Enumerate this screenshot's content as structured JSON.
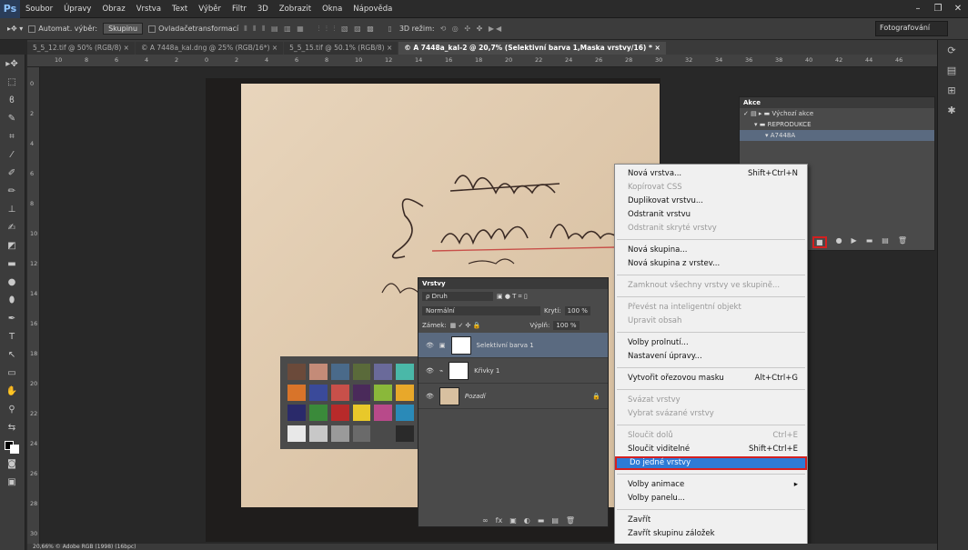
{
  "menubar": {
    "logo": "Ps",
    "items": [
      "Soubor",
      "Úpravy",
      "Obraz",
      "Vrstva",
      "Text",
      "Výběr",
      "Filtr",
      "3D",
      "Zobrazit",
      "Okna",
      "Nápověda"
    ]
  },
  "options": {
    "auto_select": "Automat. výběr:",
    "group": "Skupinu",
    "transform": "Ovladačetransformací",
    "mode3d": "3D režim:",
    "workspace": "Fotografování"
  },
  "tabs": [
    "5_5_12.tif @ 50% (RGB/8) ×",
    "© A 7448a_kal.dng @ 25% (RGB/16*) ×",
    "5_5_15.tif @ 50.1% (RGB/8) ×",
    "© A 7448a_kal-2 @ 20,7% (Selektivní barva 1,Maska vrstvy/16) * ×"
  ],
  "ruler_top": [
    "10",
    "8",
    "6",
    "4",
    "2",
    "0",
    "2",
    "4",
    "6",
    "8",
    "10",
    "12",
    "14",
    "16",
    "18",
    "20",
    "22",
    "24",
    "26",
    "28",
    "30",
    "32",
    "34",
    "36",
    "38",
    "40",
    "42",
    "44",
    "46"
  ],
  "ruler_left": [
    "0",
    "2",
    "4",
    "6",
    "8",
    "10",
    "12",
    "14",
    "16",
    "18",
    "20",
    "22",
    "24",
    "26",
    "28",
    "30"
  ],
  "status": "20,66%   © Adobe RGB (1998) (16bpc)",
  "actions": {
    "title": "Akce",
    "rows": [
      "Výchozí akce",
      "REPRODUKCE",
      "A7448A"
    ]
  },
  "layers": {
    "title": "Vrstvy",
    "filter": "ρ Druh",
    "blend": "Normální",
    "opacity_label": "Krytí:",
    "opacity": "100 %",
    "lock_label": "Zámek:",
    "fill_label": "Výplň:",
    "fill": "100 %",
    "items": [
      {
        "name": "Selektivní barva 1"
      },
      {
        "name": "Křivky 1"
      },
      {
        "name": "Pozadí"
      }
    ]
  },
  "context_menu": [
    {
      "label": "Nová vrstva...",
      "shortcut": "Shift+Ctrl+N"
    },
    {
      "label": "Kopírovat CSS",
      "disabled": true
    },
    {
      "label": "Duplikovat vrstvu..."
    },
    {
      "label": "Odstranit vrstvu"
    },
    {
      "label": "Odstranit skryté vrstvy",
      "disabled": true
    },
    {
      "sep": true
    },
    {
      "label": "Nová skupina..."
    },
    {
      "label": "Nová skupina z vrstev..."
    },
    {
      "sep": true
    },
    {
      "label": "Zamknout všechny vrstvy ve skupině...",
      "disabled": true
    },
    {
      "sep": true
    },
    {
      "label": "Převést na inteligentní objekt",
      "disabled": true
    },
    {
      "label": "Upravit obsah",
      "disabled": true
    },
    {
      "sep": true
    },
    {
      "label": "Volby prolnutí..."
    },
    {
      "label": "Nastavení úpravy..."
    },
    {
      "sep": true
    },
    {
      "label": "Vytvořit ořezovou masku",
      "shortcut": "Alt+Ctrl+G"
    },
    {
      "sep": true
    },
    {
      "label": "Svázat vrstvy",
      "disabled": true
    },
    {
      "label": "Vybrat svázané vrstvy",
      "disabled": true
    },
    {
      "sep": true
    },
    {
      "label": "Sloučit dolů",
      "shortcut": "Ctrl+E",
      "disabled": true
    },
    {
      "label": "Sloučit viditelné",
      "shortcut": "Shift+Ctrl+E"
    },
    {
      "label": "Do jedné vrstvy",
      "highlight": true
    },
    {
      "sep": true
    },
    {
      "label": "Volby animace",
      "submenu": true
    },
    {
      "label": "Volby panelu..."
    },
    {
      "sep": true
    },
    {
      "label": "Zavřít"
    },
    {
      "label": "Zavřít skupinu záložek"
    }
  ],
  "colors": {
    "highlight": "#2e7bd6",
    "accent_red": "#d42020",
    "paper": "#e2ccb0"
  },
  "checker_colors": [
    "#6b4a3a",
    "#c48b78",
    "#4a6a8a",
    "#5a6a3a",
    "#6a6a9a",
    "#4ab8a8",
    "#d8742a",
    "#3a4a9a",
    "#c8504a",
    "#4a2a5a",
    "#8ab83a",
    "#e8a82a",
    "#2a2a6a",
    "#3a8a3a",
    "#b82a2a",
    "#e8c82a",
    "#b84a8a",
    "#2a8ab8",
    "#e8e8e8",
    "#c8c8c8",
    "#9a9a9a",
    "#6a6a6a",
    "#4a4a4a",
    "#2a2a2a"
  ]
}
